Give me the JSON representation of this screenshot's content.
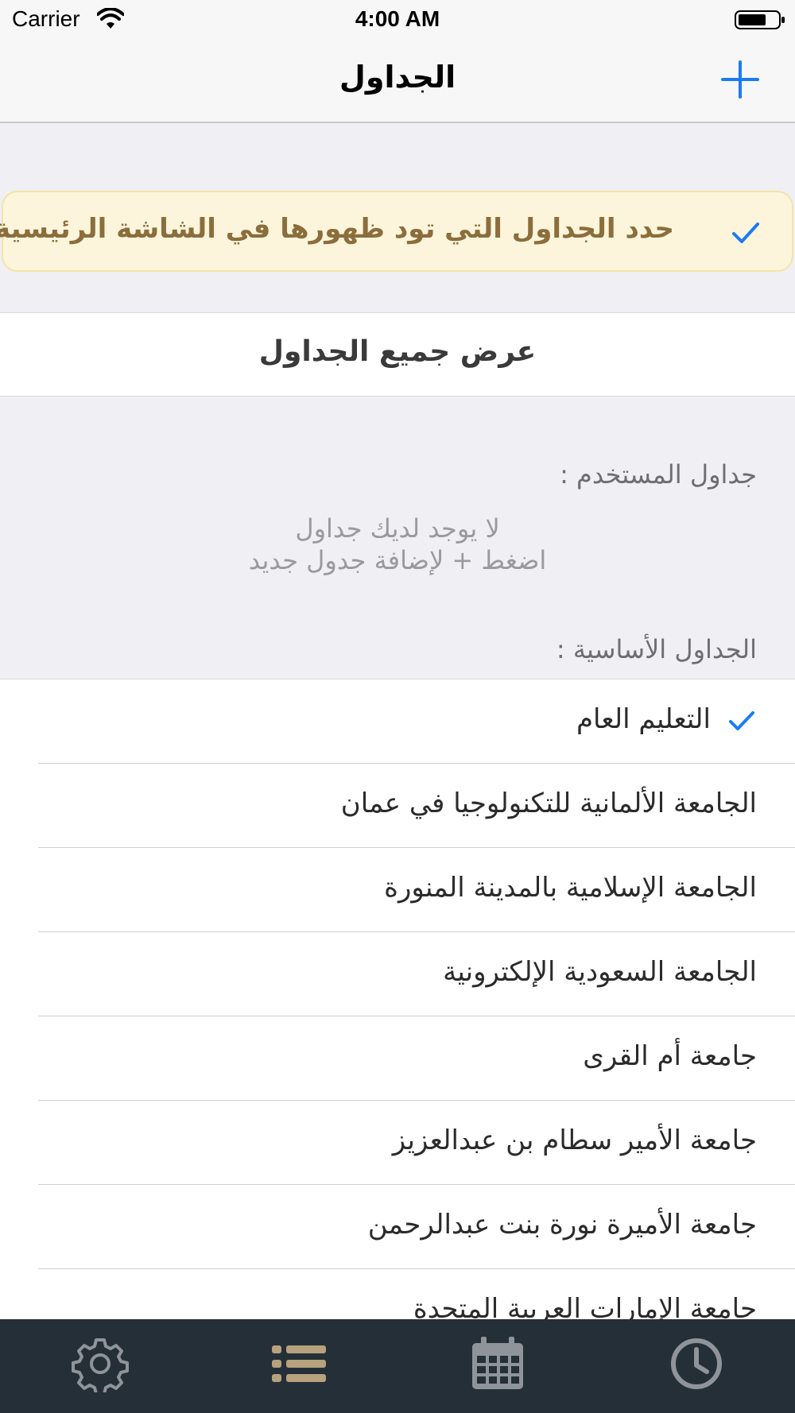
{
  "status_bar": {
    "carrier": "Carrier",
    "time": "4:00 AM",
    "icons": [
      "wifi-icon",
      "battery-icon"
    ]
  },
  "nav": {
    "title": "الجداول",
    "add_icon": "plus-icon"
  },
  "hint": {
    "text": "حدد الجداول التي تود ظهورها في الشاشة الرئيسية",
    "checked": true
  },
  "show_all": {
    "label": "عرض جميع الجداول"
  },
  "user_section": {
    "header": "جداول المستخدم :",
    "empty_line1": "لا يوجد لديك جداول",
    "empty_line2": "اضغط + لإضافة جدول جديد"
  },
  "basic_section": {
    "header": "الجداول الأساسية :",
    "items": [
      {
        "label": "التعليم العام",
        "checked": true
      },
      {
        "label": "الجامعة الألمانية للتكنولوجيا في عمان",
        "checked": false
      },
      {
        "label": "الجامعة الإسلامية بالمدينة المنورة",
        "checked": false
      },
      {
        "label": "الجامعة السعودية الإلكترونية",
        "checked": false
      },
      {
        "label": "جامعة أم القرى",
        "checked": false
      },
      {
        "label": "جامعة الأمير سطام بن عبدالعزيز",
        "checked": false
      },
      {
        "label": "جامعة الأميرة نورة بنت عبدالرحمن",
        "checked": false
      },
      {
        "label": "جامعة الإمارات العربية المتحدة",
        "checked": false
      }
    ]
  },
  "tab_bar": {
    "tabs": [
      {
        "icon": "gear-icon",
        "active": false
      },
      {
        "icon": "list-icon",
        "active": true
      },
      {
        "icon": "calendar-icon",
        "active": false
      },
      {
        "icon": "clock-icon",
        "active": false
      }
    ]
  },
  "colors": {
    "accent": "#1a7cf5",
    "tab_active": "#b6a27d",
    "tab_inactive": "#8e9499",
    "tab_bar_bg": "#252f38",
    "hint_bg": "#fcf5dc",
    "hint_text": "#8b6e3c"
  }
}
